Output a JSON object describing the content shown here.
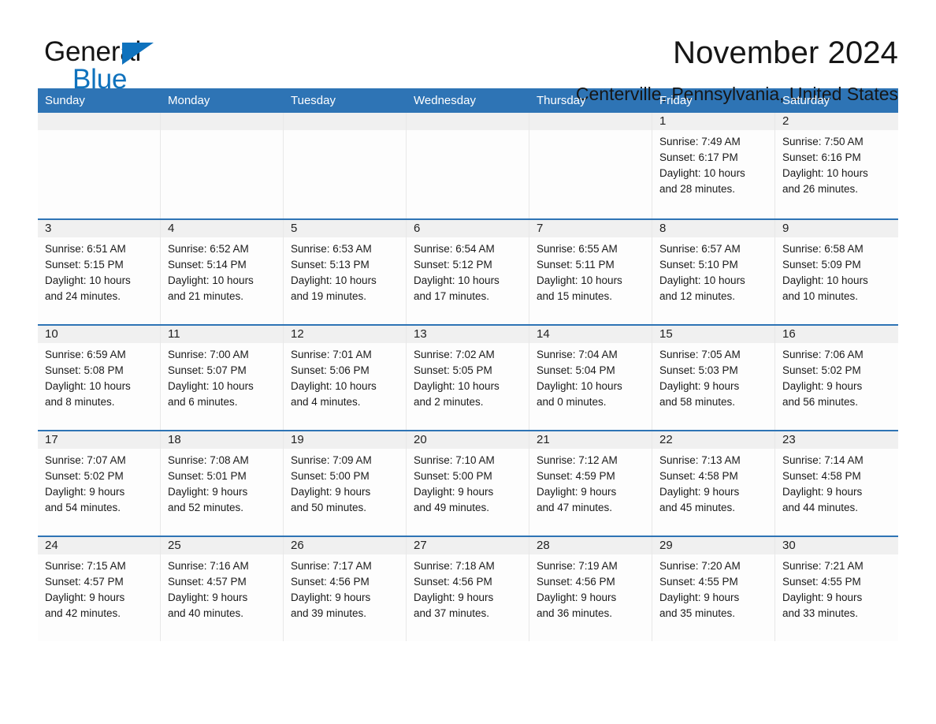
{
  "brand": {
    "name_top": "General",
    "name_bottom": "Blue",
    "accent_color": "#0f72bd",
    "triangle_icon": "triangle-icon"
  },
  "header": {
    "title": "November 2024",
    "location": "Centerville, Pennsylvania, United States",
    "header_bar_color": "#2e74b5",
    "band_color": "#f0f0f0"
  },
  "weekdays": [
    "Sunday",
    "Monday",
    "Tuesday",
    "Wednesday",
    "Thursday",
    "Friday",
    "Saturday"
  ],
  "weeks": [
    [
      {
        "day": "",
        "lines": []
      },
      {
        "day": "",
        "lines": []
      },
      {
        "day": "",
        "lines": []
      },
      {
        "day": "",
        "lines": []
      },
      {
        "day": "",
        "lines": []
      },
      {
        "day": "1",
        "lines": [
          "Sunrise: 7:49 AM",
          "Sunset: 6:17 PM",
          "Daylight: 10 hours",
          "and 28 minutes."
        ]
      },
      {
        "day": "2",
        "lines": [
          "Sunrise: 7:50 AM",
          "Sunset: 6:16 PM",
          "Daylight: 10 hours",
          "and 26 minutes."
        ]
      }
    ],
    [
      {
        "day": "3",
        "lines": [
          "Sunrise: 6:51 AM",
          "Sunset: 5:15 PM",
          "Daylight: 10 hours",
          "and 24 minutes."
        ]
      },
      {
        "day": "4",
        "lines": [
          "Sunrise: 6:52 AM",
          "Sunset: 5:14 PM",
          "Daylight: 10 hours",
          "and 21 minutes."
        ]
      },
      {
        "day": "5",
        "lines": [
          "Sunrise: 6:53 AM",
          "Sunset: 5:13 PM",
          "Daylight: 10 hours",
          "and 19 minutes."
        ]
      },
      {
        "day": "6",
        "lines": [
          "Sunrise: 6:54 AM",
          "Sunset: 5:12 PM",
          "Daylight: 10 hours",
          "and 17 minutes."
        ]
      },
      {
        "day": "7",
        "lines": [
          "Sunrise: 6:55 AM",
          "Sunset: 5:11 PM",
          "Daylight: 10 hours",
          "and 15 minutes."
        ]
      },
      {
        "day": "8",
        "lines": [
          "Sunrise: 6:57 AM",
          "Sunset: 5:10 PM",
          "Daylight: 10 hours",
          "and 12 minutes."
        ]
      },
      {
        "day": "9",
        "lines": [
          "Sunrise: 6:58 AM",
          "Sunset: 5:09 PM",
          "Daylight: 10 hours",
          "and 10 minutes."
        ]
      }
    ],
    [
      {
        "day": "10",
        "lines": [
          "Sunrise: 6:59 AM",
          "Sunset: 5:08 PM",
          "Daylight: 10 hours",
          "and 8 minutes."
        ]
      },
      {
        "day": "11",
        "lines": [
          "Sunrise: 7:00 AM",
          "Sunset: 5:07 PM",
          "Daylight: 10 hours",
          "and 6 minutes."
        ]
      },
      {
        "day": "12",
        "lines": [
          "Sunrise: 7:01 AM",
          "Sunset: 5:06 PM",
          "Daylight: 10 hours",
          "and 4 minutes."
        ]
      },
      {
        "day": "13",
        "lines": [
          "Sunrise: 7:02 AM",
          "Sunset: 5:05 PM",
          "Daylight: 10 hours",
          "and 2 minutes."
        ]
      },
      {
        "day": "14",
        "lines": [
          "Sunrise: 7:04 AM",
          "Sunset: 5:04 PM",
          "Daylight: 10 hours",
          "and 0 minutes."
        ]
      },
      {
        "day": "15",
        "lines": [
          "Sunrise: 7:05 AM",
          "Sunset: 5:03 PM",
          "Daylight: 9 hours",
          "and 58 minutes."
        ]
      },
      {
        "day": "16",
        "lines": [
          "Sunrise: 7:06 AM",
          "Sunset: 5:02 PM",
          "Daylight: 9 hours",
          "and 56 minutes."
        ]
      }
    ],
    [
      {
        "day": "17",
        "lines": [
          "Sunrise: 7:07 AM",
          "Sunset: 5:02 PM",
          "Daylight: 9 hours",
          "and 54 minutes."
        ]
      },
      {
        "day": "18",
        "lines": [
          "Sunrise: 7:08 AM",
          "Sunset: 5:01 PM",
          "Daylight: 9 hours",
          "and 52 minutes."
        ]
      },
      {
        "day": "19",
        "lines": [
          "Sunrise: 7:09 AM",
          "Sunset: 5:00 PM",
          "Daylight: 9 hours",
          "and 50 minutes."
        ]
      },
      {
        "day": "20",
        "lines": [
          "Sunrise: 7:10 AM",
          "Sunset: 5:00 PM",
          "Daylight: 9 hours",
          "and 49 minutes."
        ]
      },
      {
        "day": "21",
        "lines": [
          "Sunrise: 7:12 AM",
          "Sunset: 4:59 PM",
          "Daylight: 9 hours",
          "and 47 minutes."
        ]
      },
      {
        "day": "22",
        "lines": [
          "Sunrise: 7:13 AM",
          "Sunset: 4:58 PM",
          "Daylight: 9 hours",
          "and 45 minutes."
        ]
      },
      {
        "day": "23",
        "lines": [
          "Sunrise: 7:14 AM",
          "Sunset: 4:58 PM",
          "Daylight: 9 hours",
          "and 44 minutes."
        ]
      }
    ],
    [
      {
        "day": "24",
        "lines": [
          "Sunrise: 7:15 AM",
          "Sunset: 4:57 PM",
          "Daylight: 9 hours",
          "and 42 minutes."
        ]
      },
      {
        "day": "25",
        "lines": [
          "Sunrise: 7:16 AM",
          "Sunset: 4:57 PM",
          "Daylight: 9 hours",
          "and 40 minutes."
        ]
      },
      {
        "day": "26",
        "lines": [
          "Sunrise: 7:17 AM",
          "Sunset: 4:56 PM",
          "Daylight: 9 hours",
          "and 39 minutes."
        ]
      },
      {
        "day": "27",
        "lines": [
          "Sunrise: 7:18 AM",
          "Sunset: 4:56 PM",
          "Daylight: 9 hours",
          "and 37 minutes."
        ]
      },
      {
        "day": "28",
        "lines": [
          "Sunrise: 7:19 AM",
          "Sunset: 4:56 PM",
          "Daylight: 9 hours",
          "and 36 minutes."
        ]
      },
      {
        "day": "29",
        "lines": [
          "Sunrise: 7:20 AM",
          "Sunset: 4:55 PM",
          "Daylight: 9 hours",
          "and 35 minutes."
        ]
      },
      {
        "day": "30",
        "lines": [
          "Sunrise: 7:21 AM",
          "Sunset: 4:55 PM",
          "Daylight: 9 hours",
          "and 33 minutes."
        ]
      }
    ]
  ]
}
